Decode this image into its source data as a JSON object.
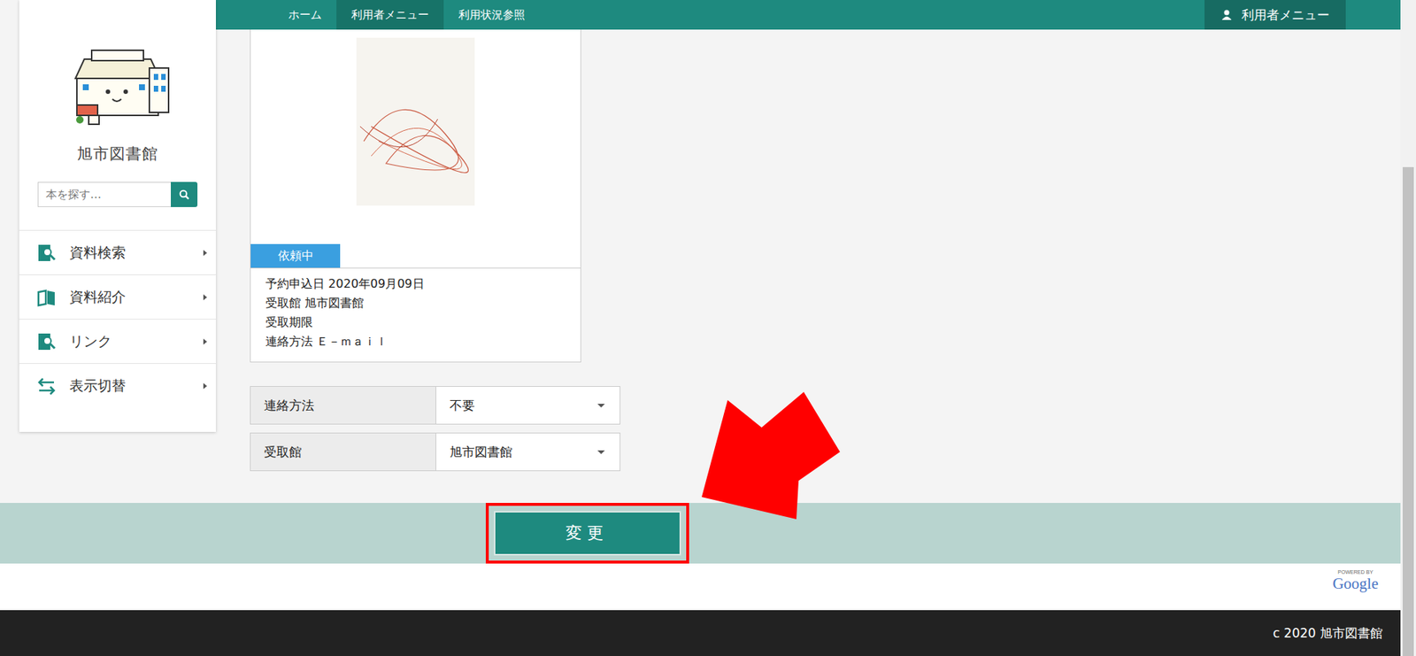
{
  "breadcrumb": [
    {
      "label": "ホーム",
      "selected": false
    },
    {
      "label": "利用者メニュー",
      "selected": true
    },
    {
      "label": "利用状況参照",
      "selected": false
    }
  ],
  "user_menu": {
    "label": "利用者メニュー"
  },
  "sidebar": {
    "title": "旭市図書館",
    "search": {
      "placeholder": "本を探す…"
    },
    "items": [
      {
        "label": "資料検索",
        "kind": "search"
      },
      {
        "label": "資料紹介",
        "kind": "book"
      },
      {
        "label": "リンク",
        "kind": "link"
      },
      {
        "label": "表示切替",
        "kind": "switch"
      }
    ]
  },
  "reservation": {
    "status": "依頼中",
    "details": [
      {
        "label": "予約申込日",
        "value": "2020年09月09日"
      },
      {
        "label": "受取館",
        "value": "旭市図書館"
      },
      {
        "label": "受取期限",
        "value": ""
      },
      {
        "label": "連絡方法",
        "value": "Ｅ－ｍａｉｌ"
      }
    ]
  },
  "form": [
    {
      "label": "連絡方法",
      "value": "不要"
    },
    {
      "label": "受取館",
      "value": "旭市図書館"
    }
  ],
  "button": {
    "label": "変更",
    "highlighted": true
  },
  "powered_by": {
    "small": "POWERED BY",
    "brand": "Google"
  },
  "footer": "c 2020 旭市図書館",
  "scrollbar": {
    "start": 0.255,
    "level": 0.745
  }
}
